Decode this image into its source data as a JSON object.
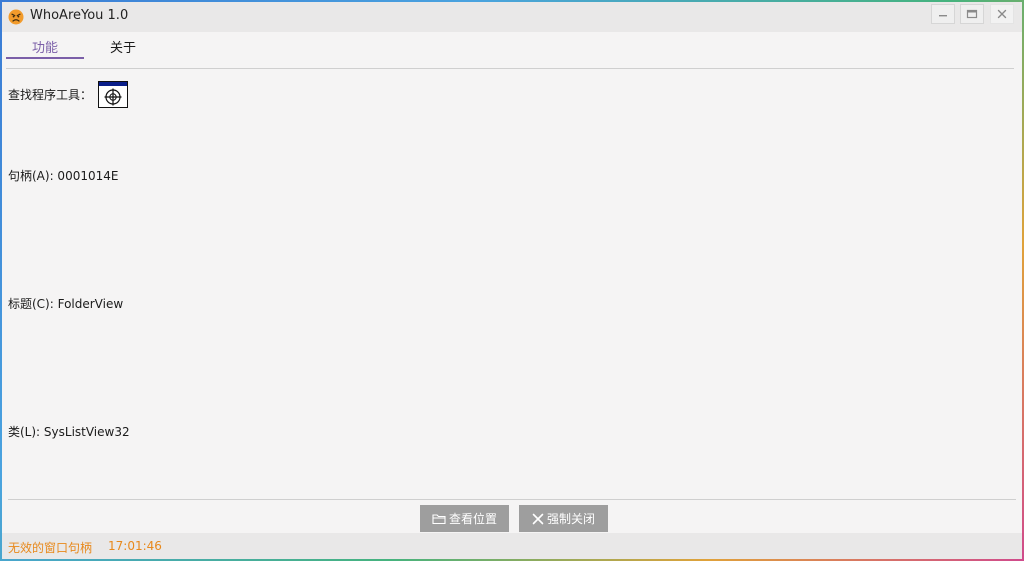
{
  "window": {
    "title": "WhoAreYou 1.0",
    "icon": "angry-face-icon"
  },
  "tabs": [
    {
      "label": "功能",
      "active": true
    },
    {
      "label": "关于",
      "active": false
    }
  ],
  "finder": {
    "label": "查找程序工具：",
    "icon": "crosshair-target-icon"
  },
  "fields": {
    "handle": "句柄(A): 0001014E",
    "caption": "标题(C): FolderView",
    "class": "类(L): SysListView32"
  },
  "buttons": {
    "view_location": "查看位置",
    "force_close": "强制关闭"
  },
  "status": {
    "message": "无效的窗口句柄",
    "time": "17:01:46"
  },
  "colors": {
    "accent": "#7b5fa8",
    "status_text": "#e8891c",
    "button_bg": "#9e9e9e",
    "window_bg": "#f5f4f4"
  }
}
